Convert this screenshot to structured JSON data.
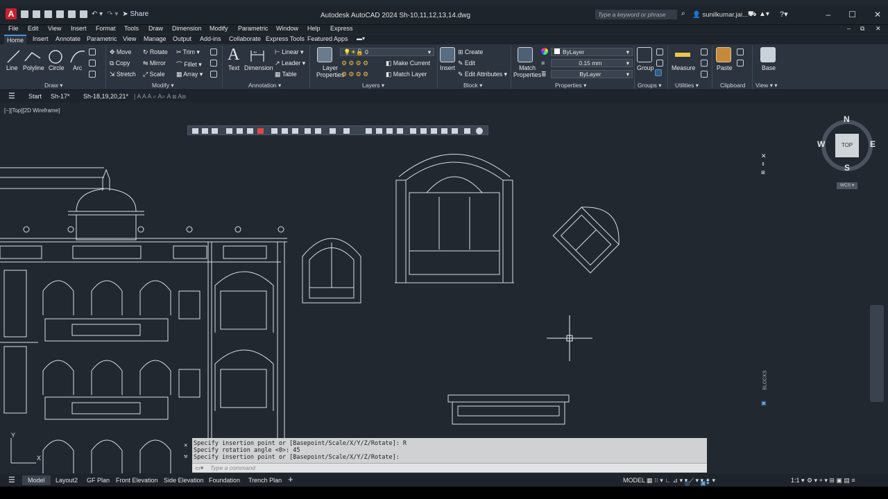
{
  "window": {
    "title": "Autodesk AutoCAD 2024   Sh-10,11,12,13,14.dwg",
    "share_label": "Share",
    "search_placeholder": "Type a keyword or phrase",
    "user": "sunilkumar.jai...",
    "minimize_icon": "minimize-icon",
    "maximize_icon": "maximize-icon",
    "close_icon": "close-icon"
  },
  "menu": [
    "File",
    "Edit",
    "View",
    "Insert",
    "Format",
    "Tools",
    "Draw",
    "Dimension",
    "Modify",
    "Parametric",
    "Window",
    "Help",
    "Express"
  ],
  "ribbon_tabs": [
    "Home",
    "Insert",
    "Annotate",
    "Parametric",
    "View",
    "Manage",
    "Output",
    "Add-ins",
    "Collaborate",
    "Express Tools",
    "Featured Apps"
  ],
  "active_ribbon_tab": "Home",
  "ribbon": {
    "draw": {
      "line": "Line",
      "polyline": "Polyline",
      "circle": "Circle",
      "arc": "Arc",
      "panel": "Draw ▾"
    },
    "modify": {
      "move": "Move",
      "rotate": "Rotate",
      "trim": "Trim ▾",
      "copy": "Copy",
      "mirror": "Mirror",
      "fillet": "Fillet ▾",
      "stretch": "Stretch",
      "scale": "Scale",
      "array": "Array ▾",
      "panel": "Modify ▾"
    },
    "annotation": {
      "text": "Text",
      "dimension": "Dimension",
      "linear": "Linear ▾",
      "leader": "Leader ▾",
      "table": "Table",
      "panel": "Annotation ▾"
    },
    "layers": {
      "layer_properties": [
        "Layer",
        "Properties"
      ],
      "current_layer": "0",
      "make_current": "Make Current",
      "match_layer": "Match Layer",
      "panel": "Layers ▾"
    },
    "block": {
      "insert": "Insert",
      "create": "Create",
      "edit": "Edit",
      "edit_attributes": "Edit Attributes ▾",
      "panel": "Block ▾"
    },
    "properties": {
      "match": [
        "Match",
        "Properties"
      ],
      "color": "ByLayer",
      "lineweight": "0.15 mm",
      "linetype": "ByLayer",
      "panel": "Properties ▾"
    },
    "groups": {
      "group": "Group",
      "panel": "Groups ▾"
    },
    "utilities": {
      "measure": "Measure",
      "panel": "Utilities ▾"
    },
    "clipboard": {
      "paste": "Paste",
      "panel": "Clipboard"
    },
    "view": {
      "base": "Base",
      "panel": "View ▾  ▾"
    }
  },
  "doc_tabs": [
    "Start",
    "Sh-17*",
    "Sh-18,19,20,21*"
  ],
  "viewport": {
    "label": "[−][Top][2D Wireframe]",
    "compass": {
      "n": "N",
      "s": "S",
      "e": "E",
      "w": "W",
      "top": "TOP",
      "ucs": "WCS"
    },
    "palette_title": "BLOCKS",
    "ucs_x": "X",
    "ucs_y": "Y"
  },
  "command": {
    "history": [
      "Specify insertion point or [Basepoint/Scale/X/Y/Z/Rotate]: R",
      "Specify rotation angle <0>: 45",
      "Specify insertion point or [Basepoint/Scale/X/Y/Z/Rotate]:"
    ],
    "placeholder": "Type a command"
  },
  "layout_tabs": [
    "Model",
    "Layout2",
    "GF Plan",
    "Front Elevation",
    "Side Elevation",
    "Foundation",
    "Trench Plan"
  ],
  "active_layout": "Model",
  "status": {
    "model": "MODEL",
    "scale": "1:1 ▾"
  }
}
